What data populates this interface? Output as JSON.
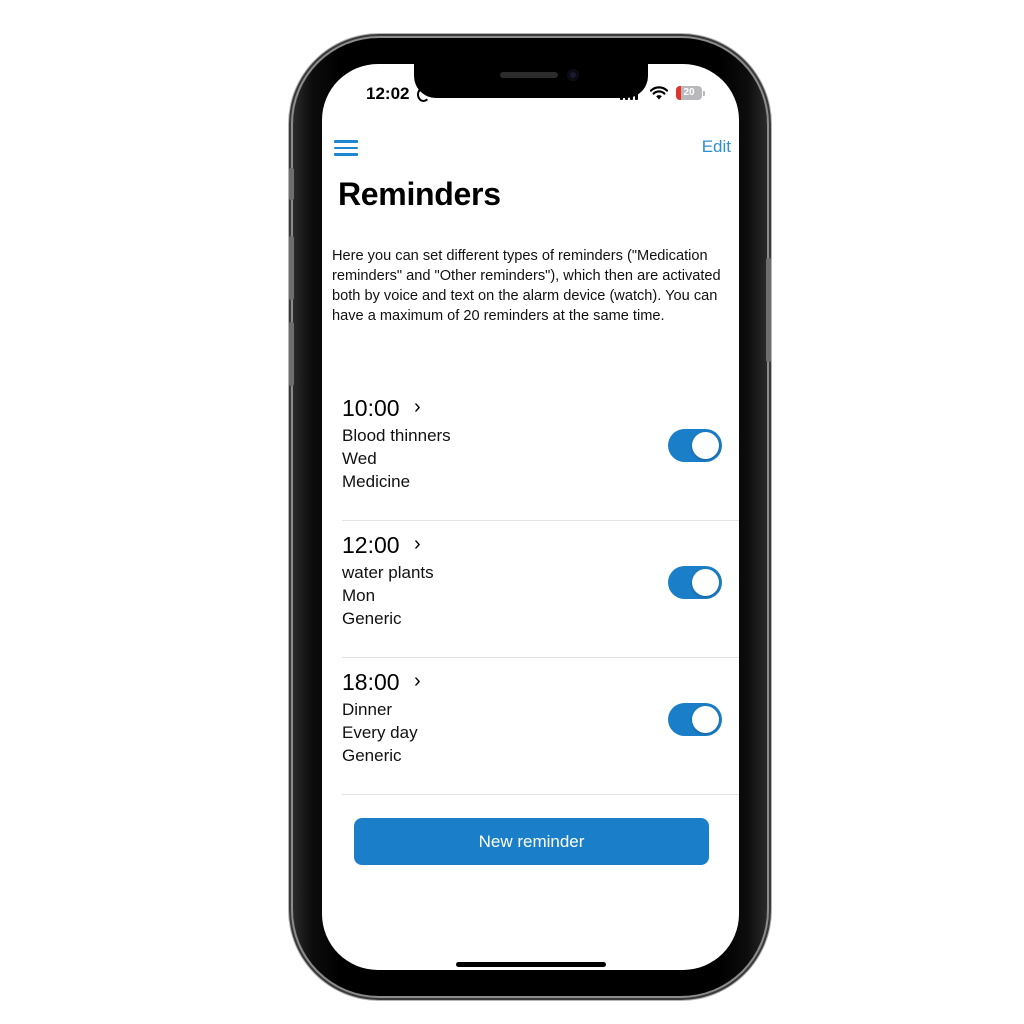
{
  "status_bar": {
    "time": "12:02",
    "battery": "20"
  },
  "nav": {
    "edit_label": "Edit"
  },
  "page": {
    "title": "Reminders",
    "description": "Here you can set different types of reminders (\"Medication reminders\" and \"Other reminders\"), which then are activated both by voice and text on the alarm device (watch). You can have a maximum of 20 reminders at the same time."
  },
  "reminders": [
    {
      "time": "10:00",
      "chevron": "›",
      "name": "Blood thinners",
      "days": "Wed",
      "type": "Medicine",
      "enabled": true
    },
    {
      "time": "12:00",
      "chevron": "›",
      "name": "water plants",
      "days": "Mon",
      "type": "Generic",
      "enabled": true
    },
    {
      "time": "18:00",
      "chevron": "›",
      "name": "Dinner",
      "days": "Every day",
      "type": "Generic",
      "enabled": true
    }
  ],
  "actions": {
    "new_reminder_label": "New reminder"
  },
  "colors": {
    "accent": "#1a7fc8",
    "link": "#2e8fcf",
    "battery_low": "#e0342c"
  },
  "icons": {
    "menu": "hamburger-menu-icon",
    "chevron": "chevron-right-icon",
    "wifi": "wifi-icon",
    "signal": "cellular-signal-icon",
    "battery": "battery-icon"
  }
}
